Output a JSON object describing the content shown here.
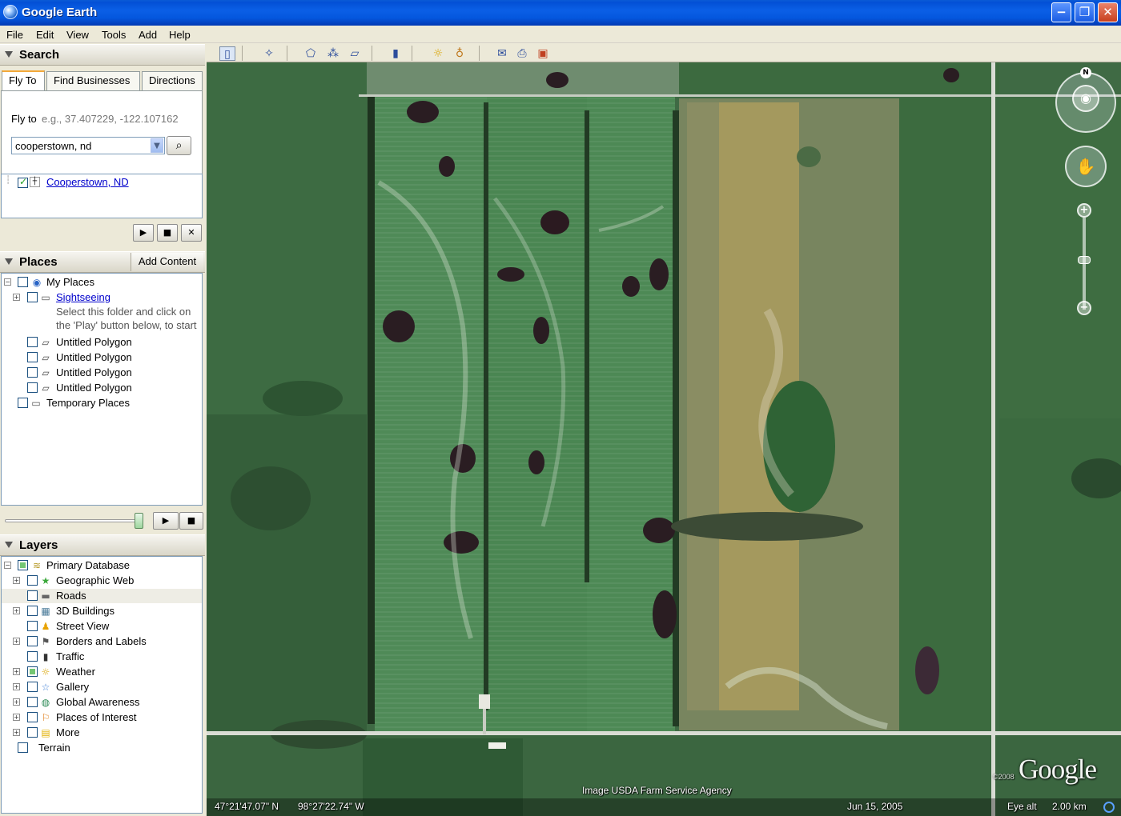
{
  "window": {
    "title": "Google Earth",
    "min_glyph": "−",
    "max_glyph": "❐",
    "close_glyph": "✕"
  },
  "menu": [
    "File",
    "Edit",
    "View",
    "Tools",
    "Add",
    "Help"
  ],
  "search": {
    "title": "Search",
    "tabs": [
      "Fly To",
      "Find Businesses",
      "Directions"
    ],
    "fly_to_label": "Fly to",
    "fly_to_hint": "e.g., 37.407229, -122.107162",
    "input_value": "cooperstown, nd",
    "result": "Cooperstown, ND"
  },
  "places": {
    "title": "Places",
    "add_content": "Add Content",
    "my_places": "My Places",
    "sightseeing": "Sightseeing",
    "sightseeing_note_1": "Select this folder and click on",
    "sightseeing_note_2": "the 'Play' button below, to start",
    "polygons": [
      "Untitled Polygon",
      "Untitled Polygon",
      "Untitled Polygon",
      "Untitled Polygon"
    ],
    "temporary": "Temporary Places"
  },
  "layers": {
    "title": "Layers",
    "primary": "Primary Database",
    "items": [
      "Geographic Web",
      "Roads",
      "3D Buildings",
      "Street View",
      "Borders and Labels",
      "Traffic",
      "Weather",
      "Gallery",
      "Global Awareness",
      "Places of Interest",
      "More"
    ],
    "terrain": "Terrain"
  },
  "map": {
    "attribution": "Image USDA Farm Service Agency",
    "latitude": "47°21'47.07\" N",
    "longitude": "98°27'22.74\" W",
    "date": "Jun 15, 2005",
    "eye_alt_label": "Eye alt",
    "eye_alt_value": "2.00 km",
    "logo": "Google",
    "copyright": "©2008",
    "north": "N"
  },
  "colors": {
    "titlebar": "#0a5ad6",
    "panel": "#ece9d8",
    "link": "#0000cc"
  }
}
